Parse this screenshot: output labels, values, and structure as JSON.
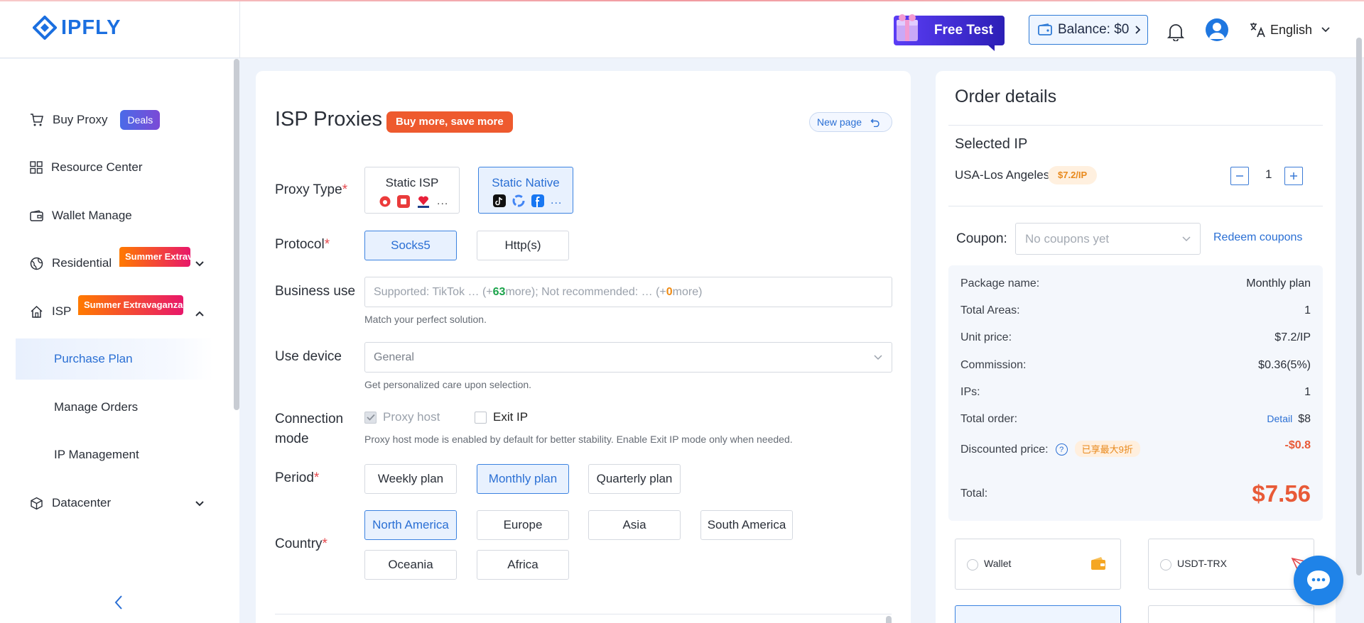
{
  "brand": {
    "name": "IPFLY",
    "color": "#1b6fe0"
  },
  "header": {
    "free_test": "Free Test",
    "balance": "Balance: $0",
    "language": "English"
  },
  "sidebar": {
    "buy_proxy": "Buy Proxy",
    "deals_badge": "Deals",
    "resource_center": "Resource Center",
    "wallet_manage": "Wallet Manage",
    "residential": "Residential",
    "residential_promo": "Summer Extrava",
    "isp": "ISP",
    "isp_promo": "Summer Extravaganza!",
    "purchase_plan": "Purchase Plan",
    "manage_orders": "Manage Orders",
    "ip_management": "IP Management",
    "datacenter": "Datacenter"
  },
  "main": {
    "title": "ISP Proxies",
    "title_badge": "Buy more, save more",
    "new_page": "New page",
    "proxy_type": {
      "label": "Proxy Type",
      "options": [
        "Static ISP",
        "Static Native"
      ],
      "selected": "Static Native",
      "more": "..."
    },
    "protocol": {
      "label": "Protocol",
      "options": [
        "Socks5",
        "Http(s)"
      ],
      "selected": "Socks5"
    },
    "business_use": {
      "label": "Business use",
      "placeholder_prefix": "Supported: TikTok … (+",
      "supported_count": "63",
      "placeholder_mid": " more); Not recommended: … (+",
      "not_recommended_count": "0",
      "placeholder_suffix": " more)",
      "hint": "Match your perfect solution."
    },
    "use_device": {
      "label": "Use device",
      "value": "General",
      "hint": "Get personalized care upon selection."
    },
    "connection_mode": {
      "label_line1": "Connection",
      "label_line2": "mode",
      "proxy_host": "Proxy host",
      "exit_ip": "Exit IP",
      "hint": "Proxy host mode is enabled by default for better stability. Enable Exit IP mode only when needed."
    },
    "period": {
      "label": "Period",
      "options": [
        "Weekly plan",
        "Monthly plan",
        "Quarterly plan"
      ],
      "selected": "Monthly plan"
    },
    "country": {
      "label": "Country",
      "options": [
        "North America",
        "Europe",
        "Asia",
        "South America",
        "Oceania",
        "Africa"
      ],
      "selected": "North America"
    }
  },
  "order": {
    "title": "Order details",
    "selected_ip_title": "Selected IP",
    "ip_location": "USA-Los Angeles",
    "ip_price": "$7.2/IP",
    "quantity": "1",
    "coupon_label": "Coupon:",
    "coupon_placeholder": "No coupons yet",
    "redeem": "Redeem coupons",
    "summary": {
      "package_name_label": "Package name:",
      "package_name": "Monthly plan",
      "total_areas_label": "Total Areas:",
      "total_areas": "1",
      "unit_price_label": "Unit price:",
      "unit_price": "$7.2/IP",
      "commission_label": "Commission:",
      "commission": "$0.36(5%)",
      "ips_label": "IPs:",
      "ips": "1",
      "total_order_label": "Total order:",
      "detail_link": "Detail",
      "total_order": "$8",
      "discounted_label": "Discounted price:",
      "discount_tag": "已享最大9折",
      "discounted": "-$0.8",
      "total_label": "Total:",
      "total": "$7.56"
    },
    "payment": [
      "Wallet",
      "USDT-TRX"
    ]
  },
  "colors": {
    "accent": "#2a6fd4",
    "danger": "#e85a37",
    "promo": "#ee5a2e"
  }
}
